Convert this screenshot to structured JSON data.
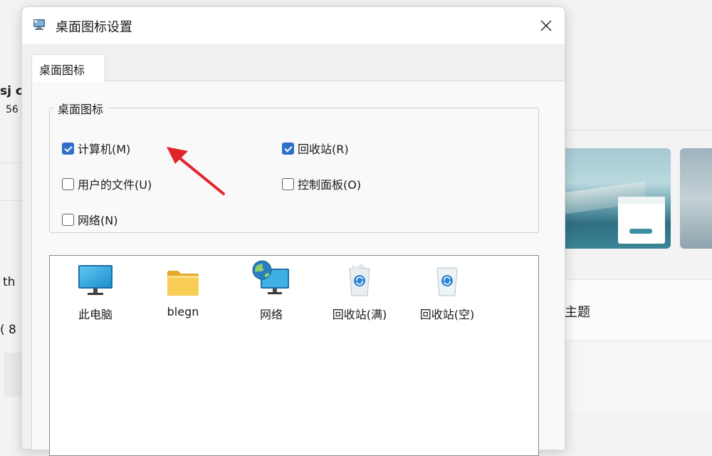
{
  "background_window": {
    "fragments": [
      "sj c",
      "56",
      "th",
      "( 8"
    ],
    "theme_label": "主题"
  },
  "dialog": {
    "title": "桌面图标设置",
    "tab": "桌面图标",
    "group_title": "桌面图标",
    "checkboxes": [
      {
        "label": "计算机(M)",
        "checked": true
      },
      {
        "label": "回收站(R)",
        "checked": true
      },
      {
        "label": "用户的文件(U)",
        "checked": false
      },
      {
        "label": "控制面板(O)",
        "checked": false
      },
      {
        "label": "网络(N)",
        "checked": false
      }
    ],
    "icons": [
      {
        "label": "此电脑",
        "icon": "monitor-icon"
      },
      {
        "label": "blegn",
        "icon": "folder-icon"
      },
      {
        "label": "网络",
        "icon": "network-globe-icon"
      },
      {
        "label": "回收站(满)",
        "icon": "recycle-bin-full-icon"
      },
      {
        "label": "回收站(空)",
        "icon": "recycle-bin-empty-icon"
      }
    ]
  },
  "colors": {
    "accent": "#2d6fcb",
    "arrow": "#e0262b"
  }
}
